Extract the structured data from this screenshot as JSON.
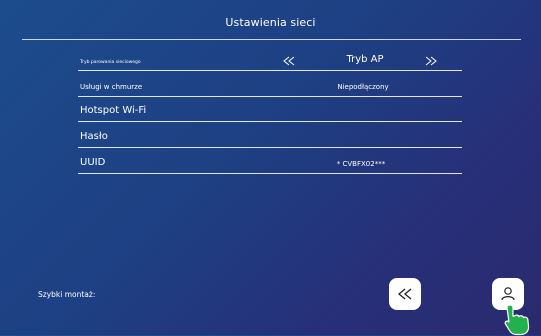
{
  "header": {
    "title": "Ustawienia sieci"
  },
  "settings": {
    "rows": [
      {
        "label": "Tryb parowania sieciowego",
        "value": "Tryb AP"
      },
      {
        "label": "Usługi w chmurze",
        "value": "Niepodłączony"
      },
      {
        "label": "Hotspot Wi-Fi",
        "value": ""
      },
      {
        "label": "Hasło",
        "value": ""
      },
      {
        "label": "UUID",
        "value": "* CVBFX02***"
      }
    ]
  },
  "footer": {
    "quick_install_label": "Szybki montaż:"
  },
  "icons": {
    "prev_mode": "chevron-double-left-icon",
    "next_mode": "chevron-double-right-icon",
    "back": "back-arrow-icon",
    "user": "user-icon",
    "pointer": "tap-hand-icon"
  },
  "colors": {
    "background_start": "#1c4c8c",
    "background_end": "#2b2a6e",
    "text": "#ffffff",
    "divider": "#dfe7f5",
    "pointer": "#22b14c"
  }
}
